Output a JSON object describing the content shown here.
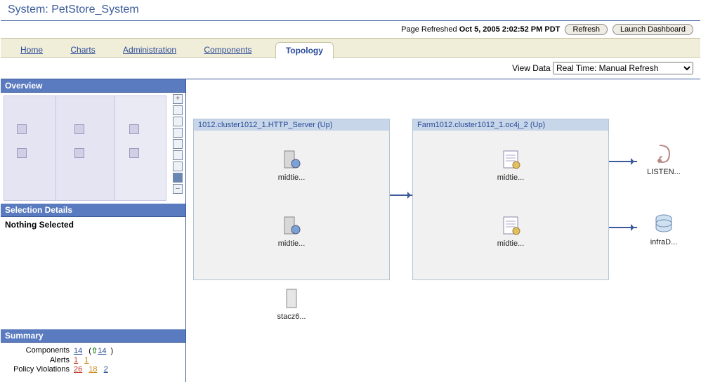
{
  "title": "System: PetStore_System",
  "status": {
    "refreshed_label": "Page Refreshed",
    "refreshed_ts": "Oct 5, 2005 2:02:52 PM PDT",
    "refresh_btn": "Refresh",
    "dashboard_btn": "Launch Dashboard"
  },
  "tabs": {
    "home": "Home",
    "charts": "Charts",
    "admin": "Administration",
    "components": "Components",
    "topology": "Topology"
  },
  "view": {
    "label": "View Data",
    "selected": "Real Time: Manual Refresh"
  },
  "side": {
    "overview_title": "Overview",
    "selection_title": "Selection Details",
    "selection_body": "Nothing Selected",
    "summary_title": "Summary",
    "summary": {
      "components_label": "Components",
      "components_total": "14",
      "components_up": "14",
      "alerts_label": "Alerts",
      "alerts_a": "1",
      "alerts_b": "1",
      "policy_label": "Policy Violations",
      "policy_a": "26",
      "policy_b": "18",
      "policy_c": "2"
    }
  },
  "topology": {
    "group1_title": "1012.cluster1012_1.HTTP_Server (Up)",
    "group2_title": "Farm1012.cluster1012_1.oc4j_2 (Up)",
    "g1n1": "midtie...",
    "g1n2": "midtie...",
    "g1n3": "stacz6...",
    "g2n1": "midtie...",
    "g2n2": "midtie...",
    "ext1": "LISTEN...",
    "ext2": "infraD..."
  }
}
